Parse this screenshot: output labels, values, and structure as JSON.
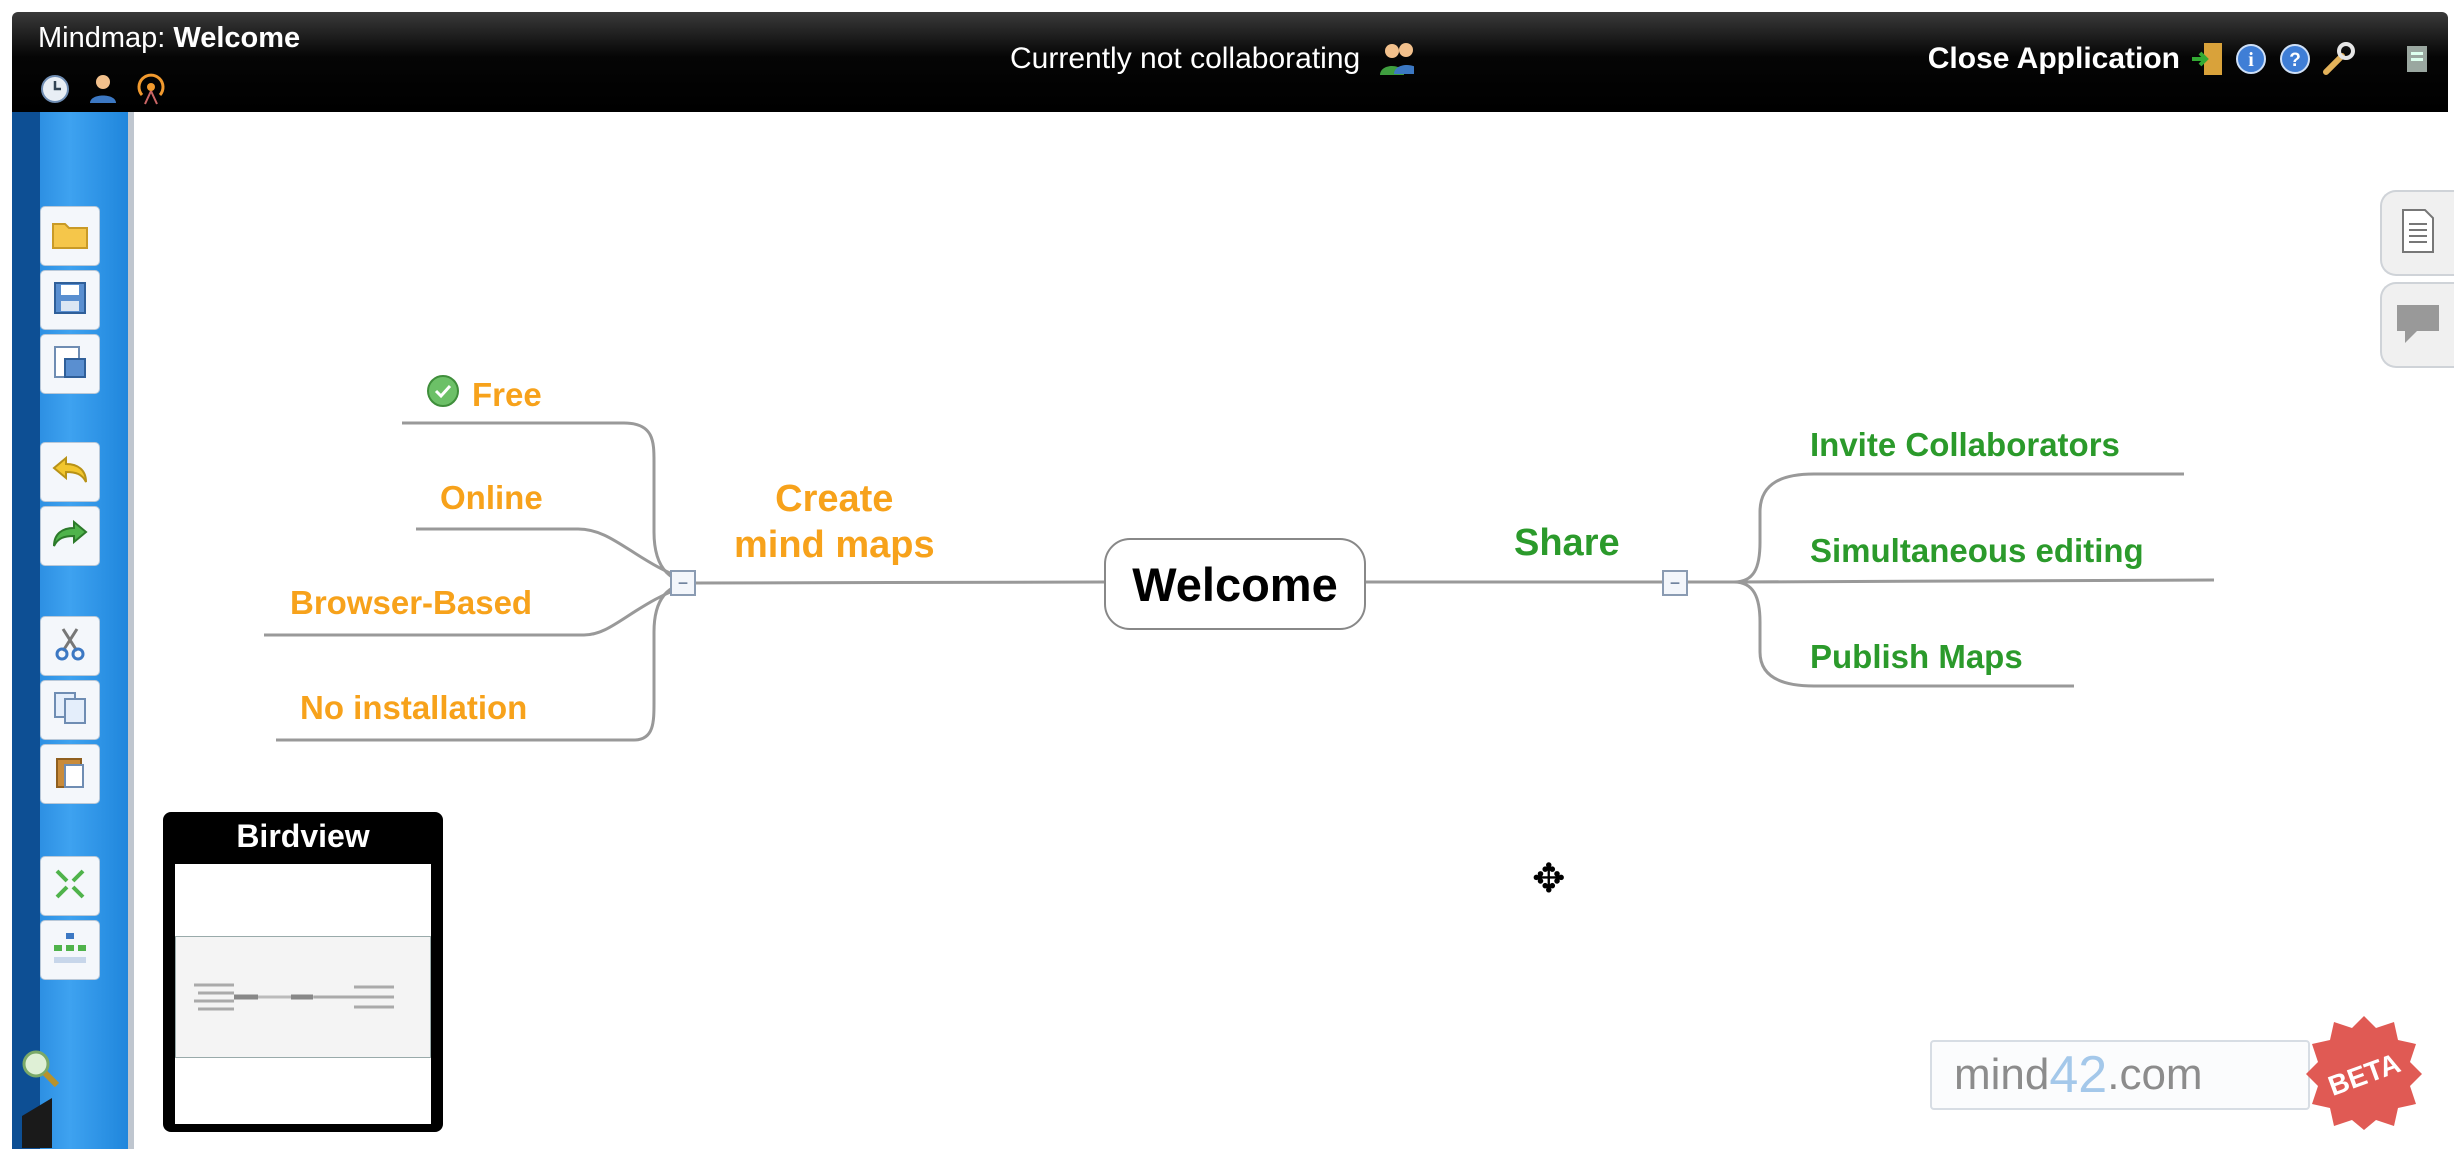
{
  "window": {
    "title_prefix": "Mindmap: ",
    "title_name": "Welcome",
    "collab_status": "Currently not collaborating",
    "close_label": "Close Application"
  },
  "map": {
    "center": "Welcome",
    "left_branch": {
      "label_line1": "Create",
      "label_line2": "mind maps",
      "color": "#f7a21b",
      "children": [
        "Free",
        "Online",
        "Browser-Based",
        "No installation"
      ]
    },
    "right_branch": {
      "label": "Share",
      "color": "#2b9a2b",
      "children": [
        "Invite Collaborators",
        "Simultaneous editing",
        "Publish Maps"
      ]
    }
  },
  "birdview": {
    "title": "Birdview"
  },
  "logo": {
    "text_a": "mind",
    "text_b": "42",
    "text_c": ".com",
    "badge": "BETA"
  },
  "icons": {
    "topbar": [
      "clock-icon",
      "user-icon",
      "broadcast-icon"
    ],
    "collab": "users-icon",
    "right": [
      "exit-door-icon",
      "info-icon",
      "help-icon",
      "wrench-icon",
      "document-icon"
    ],
    "left_toolbar": [
      "open-folder-icon",
      "save-icon",
      "save-as-icon",
      "undo-icon",
      "redo-icon",
      "cut-icon",
      "copy-icon",
      "paste-icon",
      "expand-collapse-icon",
      "layout-tree-icon"
    ],
    "side_tabs": [
      "notes-icon",
      "comment-icon"
    ]
  }
}
